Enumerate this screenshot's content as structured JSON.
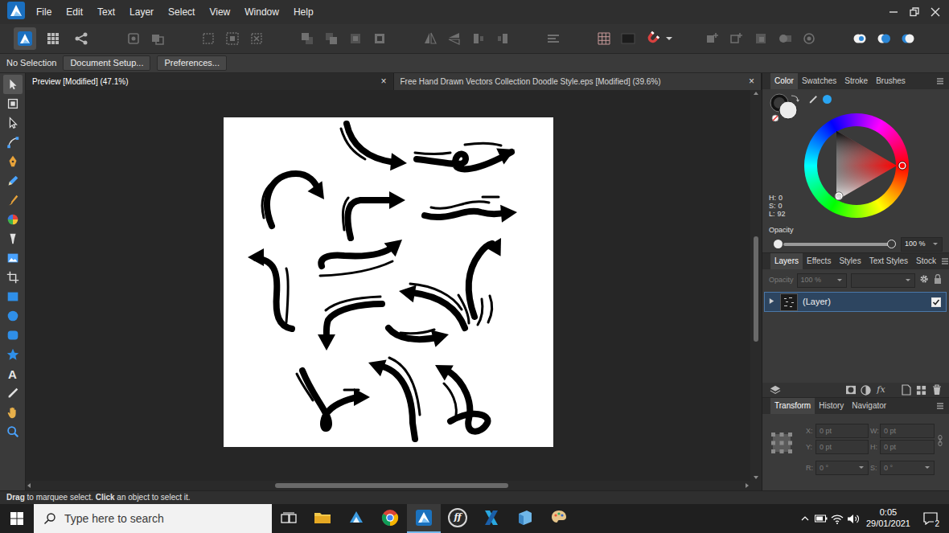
{
  "menu_bar": {
    "items": [
      "File",
      "Edit",
      "Text",
      "Layer",
      "Select",
      "View",
      "Window",
      "Help"
    ]
  },
  "toolbar": {
    "personas": [
      {
        "selected": true
      },
      {
        "selected": false
      },
      {
        "selected": false
      }
    ],
    "snapping": {
      "on": true
    }
  },
  "context_bar": {
    "selection": "No Selection",
    "buttons": [
      "Document Setup...",
      "Preferences..."
    ]
  },
  "tools": [
    {
      "kind": "icon",
      "selected": true
    },
    {
      "kind": "icon",
      "selected": false
    },
    {
      "kind": "icon",
      "selected": false
    },
    {
      "kind": "icon",
      "selected": false
    },
    {
      "kind": "icon",
      "selected": false
    },
    {
      "kind": "icon",
      "selected": false
    },
    {
      "kind": "icon",
      "selected": false
    },
    {
      "kind": "icon",
      "selected": false
    },
    {
      "kind": "icon",
      "selected": false
    },
    {
      "kind": "icon",
      "selected": false
    },
    {
      "kind": "icon",
      "selected": false
    },
    {
      "kind": "icon",
      "selected": false
    },
    {
      "kind": "icon",
      "selected": false
    },
    {
      "kind": "icon",
      "selected": false
    },
    {
      "kind": "icon",
      "selected": false
    },
    {
      "kind": "glyph",
      "label": "A",
      "selected": false
    },
    {
      "kind": "icon",
      "selected": false
    },
    {
      "kind": "icon",
      "selected": false
    },
    {
      "kind": "icon",
      "selected": false
    }
  ],
  "documents": [
    {
      "title": "Preview [Modified] (47.1%)",
      "close": "×",
      "selected": true
    },
    {
      "title": "Free Hand Drawn Vectors Collection Doodle Style.eps [Modified] (39.6%)",
      "close": "×",
      "selected": false
    }
  ],
  "canvas": {
    "scrollbars": {
      "vertical": {
        "level": 0.28,
        "offset": 0.37
      },
      "horizontal": {
        "level": 0.33,
        "offset": 0.34
      }
    }
  },
  "color_panel": {
    "tabs": [
      {
        "label": "Color",
        "selected": true
      },
      {
        "label": "Swatches",
        "selected": false
      },
      {
        "label": "Stroke",
        "selected": false
      },
      {
        "label": "Brushes",
        "selected": false
      }
    ],
    "hsl": [
      {
        "label": "H:",
        "value": "0"
      },
      {
        "label": "S:",
        "value": "0"
      },
      {
        "label": "L:",
        "value": "92"
      }
    ],
    "opacity": {
      "label": "Opacity",
      "level": 1,
      "reading": "100 %"
    }
  },
  "layers_panel": {
    "tabs": [
      {
        "label": "Layers",
        "selected": true
      },
      {
        "label": "Effects",
        "selected": false
      },
      {
        "label": "Styles",
        "selected": false
      },
      {
        "label": "Text Styles",
        "selected": false
      },
      {
        "label": "Stock",
        "selected": false
      }
    ],
    "opacity": {
      "label": "Opacity",
      "value": "100 %",
      "disabled": true
    },
    "layers": [
      {
        "name": "(Layer)",
        "expanded": false,
        "visible": true,
        "selected": true
      }
    ],
    "effects_button": "fx"
  },
  "transform_panel": {
    "tabs": [
      {
        "label": "Transform",
        "selected": true
      },
      {
        "label": "History",
        "selected": false
      },
      {
        "label": "Navigator",
        "selected": false
      }
    ],
    "disabled": true,
    "fields": [
      {
        "label": "X:",
        "value": "0 pt",
        "kind": "number"
      },
      {
        "label": "W:",
        "value": "0 pt",
        "kind": "number"
      },
      {
        "label": "Y:",
        "value": "0 pt",
        "kind": "number"
      },
      {
        "label": "H:",
        "value": "0 pt",
        "kind": "number"
      },
      {
        "label": "R:",
        "value": "0 °",
        "kind": "dropdown"
      },
      {
        "label": "S:",
        "value": "0 °",
        "kind": "dropdown"
      }
    ]
  },
  "status_bar": {
    "parts": [
      {
        "text": "Drag",
        "bold": true
      },
      {
        "text": "to marquee select.",
        "bold": false
      },
      {
        "text": "Click",
        "bold": true
      },
      {
        "text": "an object to select it.",
        "bold": false
      }
    ]
  },
  "taskbar": {
    "search": {
      "placeholder": "Type here to search"
    },
    "apps": [
      {
        "kind": "icon",
        "selected": false
      },
      {
        "kind": "icon",
        "selected": false
      },
      {
        "kind": "icon",
        "selected": false
      },
      {
        "kind": "icon",
        "selected": true
      },
      {
        "kind": "glyph",
        "label": "ff",
        "selected": false
      },
      {
        "kind": "icon",
        "selected": false
      },
      {
        "kind": "icon",
        "selected": false
      },
      {
        "kind": "icon",
        "selected": false
      }
    ],
    "clock": {
      "time": "0:05",
      "date": "29/01/2021"
    },
    "notifications": {
      "count": "2"
    }
  }
}
